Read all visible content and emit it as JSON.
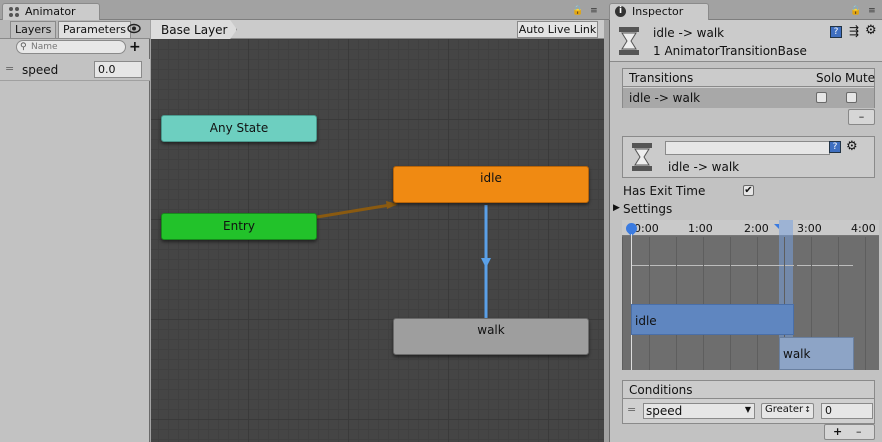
{
  "animator": {
    "tab_label": "Animator",
    "subtabs": [
      "Layers",
      "Parameters"
    ],
    "search_placeholder": "Name",
    "parameter": {
      "name": "speed",
      "value": "0.0"
    },
    "breadcrumb": "Base Layer",
    "auto_live_link": "Auto Live Link",
    "nodes": {
      "any_state": "Any State",
      "entry": "Entry",
      "idle": "idle",
      "walk": "walk"
    }
  },
  "inspector": {
    "tab_label": "Inspector",
    "header_title": "idle -> walk",
    "header_subtitle": "1 AnimatorTransitionBase",
    "transitions_header": "Transitions",
    "solo_label": "Solo",
    "mute_label": "Mute",
    "transition_row": "idle -> walk",
    "remove_label": "–",
    "transition_name": "idle -> walk",
    "has_exit_time_label": "Has Exit Time",
    "has_exit_time": true,
    "settings_label": "Settings",
    "timeline_ticks": [
      "0:00",
      "1:00",
      "2:00",
      "3:00",
      "4:00"
    ],
    "timeline_clips": {
      "source": "idle",
      "target": "walk"
    },
    "conditions_label": "Conditions",
    "condition": {
      "parameter": "speed",
      "mode": "Greater",
      "value": "0"
    },
    "add_label": "+",
    "minus_label": "–"
  },
  "colors": {
    "any_state": "#6dcfc0",
    "entry": "#22c22a",
    "idle": "#f08a12",
    "walk": "#9e9e9e",
    "transition_arrow": "#5aa0e8",
    "entry_arrow": "#8a5a10"
  }
}
